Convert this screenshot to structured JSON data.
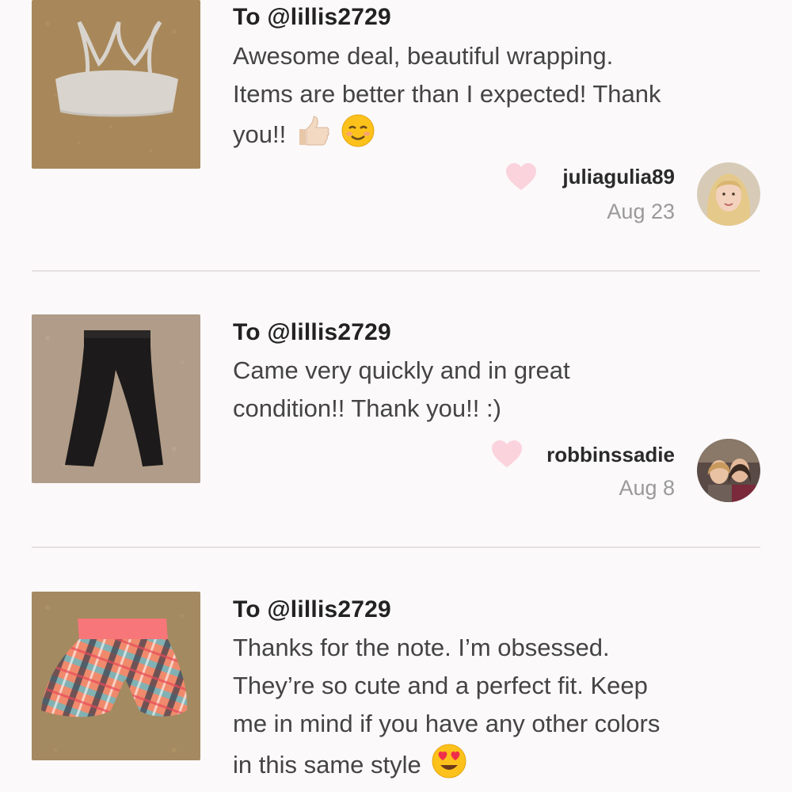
{
  "reviews": [
    {
      "to": "To @lillis2729",
      "message_lines": [
        "Awesome deal, beautiful wrapping.",
        "Items are better than I expected! Thank",
        "you!!"
      ],
      "emojis": [
        "thumbs-up-icon",
        "smiling-face-icon"
      ],
      "username": "juliagulia89",
      "date": "Aug 23",
      "item_image": "sports-bra-photo"
    },
    {
      "to": "To @lillis2729",
      "message_lines": [
        "Came very quickly and in great",
        "condition!! Thank you!! :)"
      ],
      "username": "robbinssadie",
      "date": "Aug 8",
      "item_image": "black-leggings-photo"
    },
    {
      "to": "To @lillis2729",
      "message_lines": [
        "Thanks for the note. I’m obsessed.",
        "They’re so cute and a perfect fit. Keep",
        "me in mind if you have any other colors",
        "in this same style"
      ],
      "emojis": [
        "heart-eyes-icon"
      ],
      "item_image": "plaid-shorts-photo"
    }
  ],
  "colors": {
    "heart": "#fbd3dd",
    "divider": "#e4e0e2",
    "date": "#9a9a9a"
  }
}
